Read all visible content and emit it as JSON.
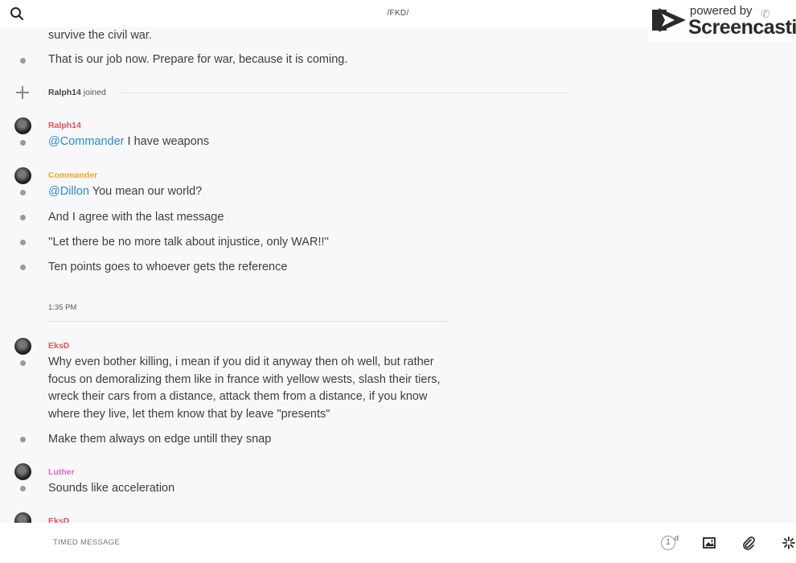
{
  "header": {
    "channel": "/FKD/",
    "search_icon": "search-icon"
  },
  "watermark": {
    "small": "powered by",
    "big": "Screencastify",
    "logo_icon": "play-arrow-icon",
    "phone_icon": "phone-icon"
  },
  "feed": {
    "top_text_1": "survive the civil war.",
    "top_text_2": "That is our job now. Prepare for war, because it is coming.",
    "join_event": {
      "user": "Ralph14",
      "text": "joined"
    },
    "ralph": {
      "user": "Ralph14",
      "color": "#e8505b",
      "mention": "@Commander",
      "text": " I have weapons"
    },
    "commander": {
      "user": "Commander",
      "color": "#f5a623",
      "m1_mention": "@Dillon",
      "m1_text": " You mean our world?",
      "m2": "And I agree with the last message",
      "m3": "''Let there be no more talk about injustice, only WAR!!''",
      "m4": "Ten points goes to whoever gets the reference"
    },
    "timestamp": "1:35 PM",
    "eksd": {
      "user": "EksD",
      "color": "#e8505b",
      "m1_l1": "Why even bother killing, i mean if you did it anyway then oh well, but rather",
      "m1_l2": "focus on demoralizing them like in france with yellow wests, slash their tiers,",
      "m1_l3": "wreck their cars from a distance, attack them from a distance, if you know",
      "m1_l4": "where they live, let them know that by leave \"presents\"",
      "m2": "Make them always on edge untill they snap"
    },
    "luther": {
      "user": "Luther",
      "color": "#e667c8",
      "m1": "Sounds like acceleration"
    },
    "eksd2": {
      "user": "EksD"
    }
  },
  "composer": {
    "placeholder": "TIMED MESSAGE",
    "timer_value": "1",
    "timer_unit": "d",
    "icons": [
      "image-icon",
      "paperclip-icon",
      "sparkle-icon"
    ]
  },
  "colors": {
    "mention": "#2e8bcb",
    "background": "#f8f8fa"
  }
}
